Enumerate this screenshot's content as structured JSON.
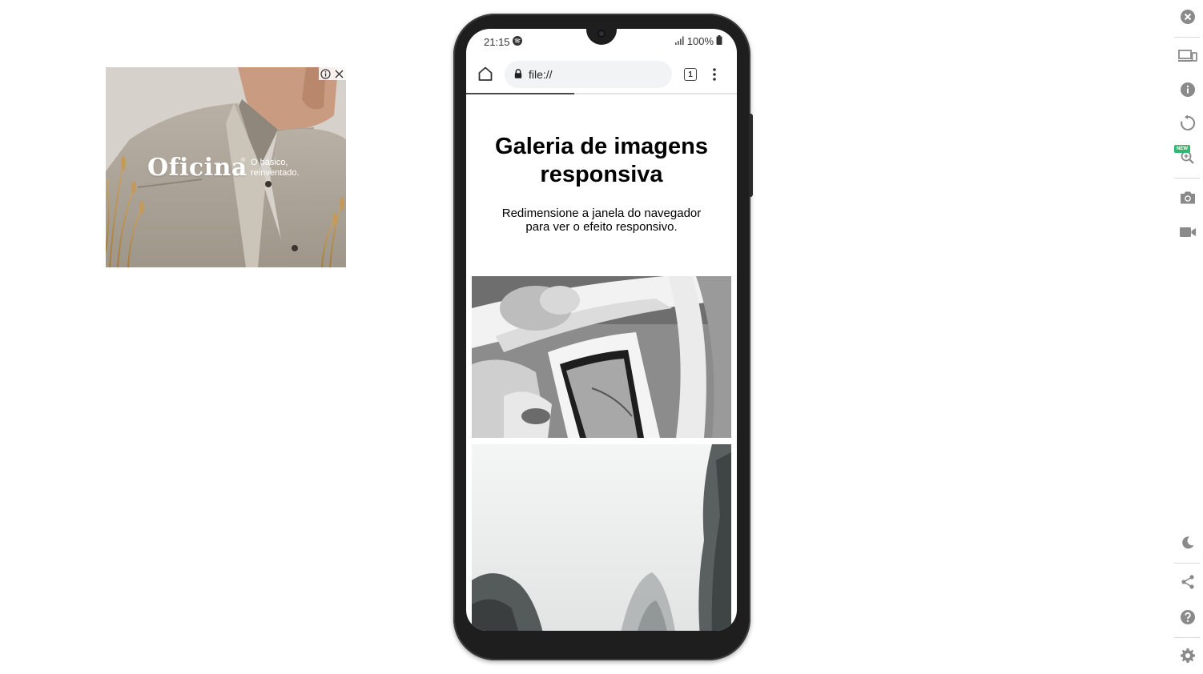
{
  "ad": {
    "brand": "Oficina",
    "registered_mark": "®",
    "tagline": "O básico, reinventado.",
    "info_icon": "info-icon",
    "close_icon": "close-icon"
  },
  "phone": {
    "status_bar": {
      "time": "21:15",
      "app_icon": "spotify-icon",
      "battery_percent": "100%",
      "signal_icon": "signal-icon",
      "battery_icon": "battery-icon"
    },
    "browser": {
      "url": "file://",
      "tab_count": "1",
      "home_icon": "home-icon",
      "lock_icon": "lock-icon",
      "menu_icon": "more-vertical-icon",
      "load_progress": 0.4
    },
    "page": {
      "title": "Galeria de imagens responsiva",
      "description": "Redimensione a janela do navegador para ver o efeito responsivo.",
      "images": [
        {
          "subject": "couple-in-vintage-car-bw"
        },
        {
          "subject": "misty-mountain-cliffs"
        }
      ]
    }
  },
  "toolbar": {
    "items": [
      {
        "icon": "close-circle-icon"
      },
      {
        "icon": "devices-icon"
      },
      {
        "icon": "info-icon"
      },
      {
        "icon": "rotate-icon"
      },
      {
        "icon": "zoom-icon",
        "badge": "NEW"
      },
      {
        "icon": "camera-icon"
      },
      {
        "icon": "video-icon"
      },
      {
        "icon": "moon-icon"
      },
      {
        "icon": "share-icon"
      },
      {
        "icon": "help-icon"
      },
      {
        "icon": "settings-icon"
      }
    ]
  },
  "colors": {
    "toolbar_icon": "#8a8a8a",
    "phone_body": "#1e1e1e",
    "new_badge": "#2eb872",
    "url_bar": "#f1f3f4"
  }
}
